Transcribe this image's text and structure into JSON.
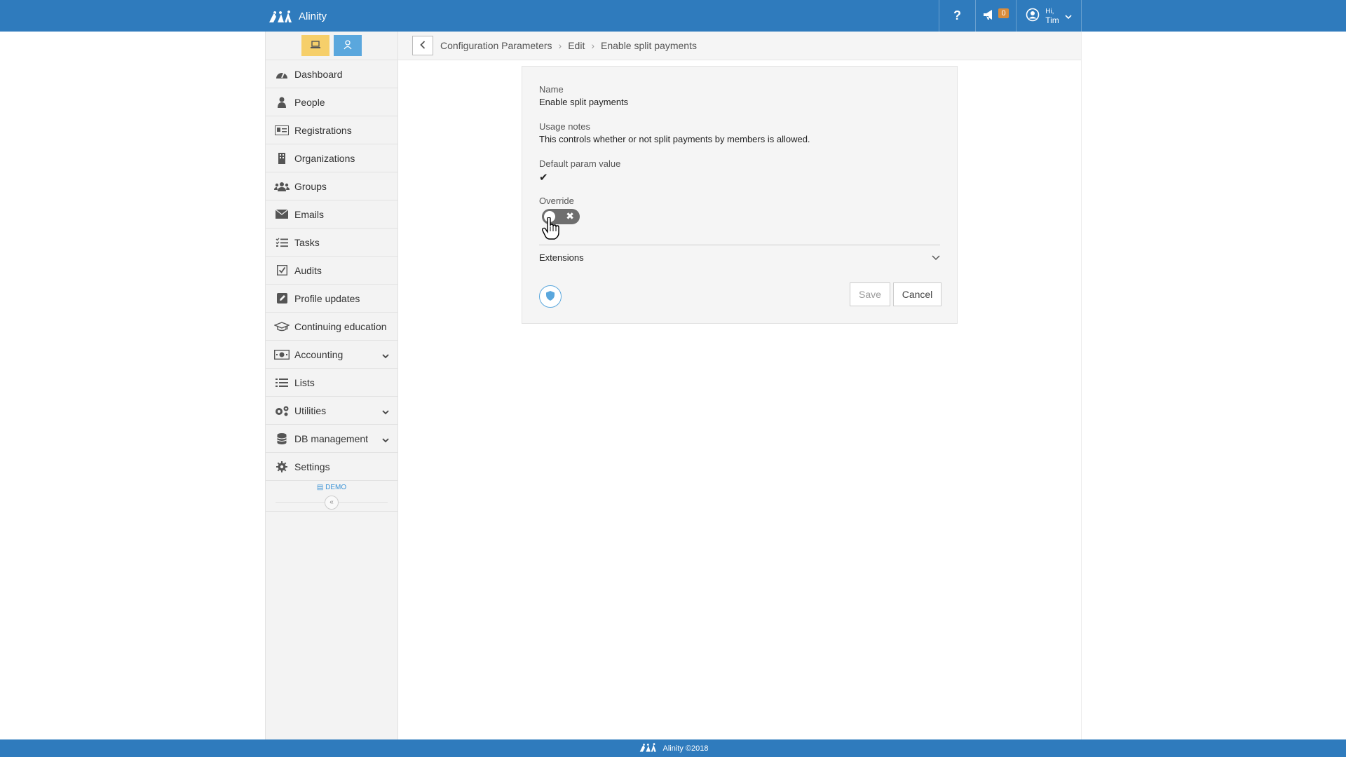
{
  "app": {
    "name": "Alinity"
  },
  "topbar": {
    "help_label": "?",
    "notifications_count": "0",
    "user_greeting": "Hi,",
    "user_name": "Tim"
  },
  "sidebar": {
    "items": [
      {
        "label": "Dashboard",
        "icon": "dashboard-icon"
      },
      {
        "label": "People",
        "icon": "person-icon"
      },
      {
        "label": "Registrations",
        "icon": "id-card-icon"
      },
      {
        "label": "Organizations",
        "icon": "building-icon"
      },
      {
        "label": "Groups",
        "icon": "users-icon"
      },
      {
        "label": "Emails",
        "icon": "envelope-icon"
      },
      {
        "label": "Tasks",
        "icon": "tasks-icon"
      },
      {
        "label": "Audits",
        "icon": "checkbox-icon"
      },
      {
        "label": "Profile updates",
        "icon": "edit-icon"
      },
      {
        "label": "Continuing education",
        "icon": "graduation-cap-icon"
      },
      {
        "label": "Accounting",
        "icon": "money-icon",
        "expandable": true
      },
      {
        "label": "Lists",
        "icon": "list-icon"
      },
      {
        "label": "Utilities",
        "icon": "cogs-icon",
        "expandable": true
      },
      {
        "label": "DB management",
        "icon": "database-icon",
        "expandable": true
      },
      {
        "label": "Settings",
        "icon": "gear-icon"
      }
    ],
    "demo_label": "DEMO",
    "collapse_glyph": "«"
  },
  "breadcrumb": {
    "items": [
      "Configuration Parameters",
      "Edit",
      "Enable split payments"
    ],
    "separator": "›"
  },
  "form": {
    "name_label": "Name",
    "name_value": "Enable split payments",
    "usage_label": "Usage notes",
    "usage_value": "This controls whether or not split payments by members is allowed.",
    "default_label": "Default param value",
    "default_value_glyph": "✔",
    "override_label": "Override",
    "override_state": "off",
    "extensions_label": "Extensions",
    "save_label": "Save",
    "cancel_label": "Cancel"
  },
  "footer": {
    "text": "Alinity ©2018"
  },
  "colors": {
    "brand": "#2f7bbd",
    "mode_desk": "#f6cf6a",
    "mode_user": "#5aa7dd",
    "toggle_off": "#6e6e6e"
  }
}
